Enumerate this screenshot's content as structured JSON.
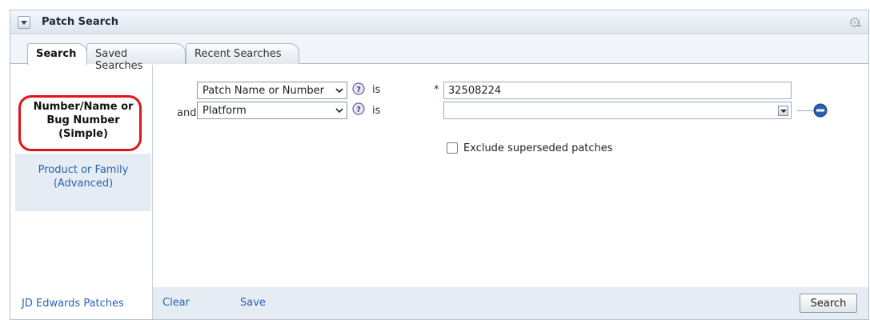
{
  "panel": {
    "title": "Patch Search"
  },
  "tabs": [
    {
      "label": "Search",
      "active": true
    },
    {
      "label": "Saved Searches",
      "active": false
    },
    {
      "label": "Recent Searches",
      "active": false
    }
  ],
  "left_nav": {
    "simple": {
      "line1": "Number/Name or",
      "line2": "Bug Number",
      "line3": "(Simple)"
    },
    "advanced": {
      "line1": "Product or Family",
      "line2": "(Advanced)"
    },
    "jd_edwards": "JD Edwards Patches"
  },
  "criteria": [
    {
      "conjunction": "",
      "field": "Patch Name or Number",
      "operator": "is",
      "required_marker": "*",
      "value": "32508224"
    },
    {
      "conjunction": "and",
      "field": "Platform",
      "operator": "is",
      "value": ""
    }
  ],
  "exclude_superseded": {
    "label": "Exclude superseded patches",
    "checked": false
  },
  "footer": {
    "clear": "Clear",
    "save": "Save",
    "search": "Search"
  },
  "colors": {
    "link": "#2a62b2",
    "highlight": "#e0141c",
    "remove_icon": "#2d5fb0"
  },
  "icons": {
    "collapse": "collapse-icon",
    "settings": "gear-icon",
    "help": "help-icon",
    "remove": "remove-icon"
  }
}
